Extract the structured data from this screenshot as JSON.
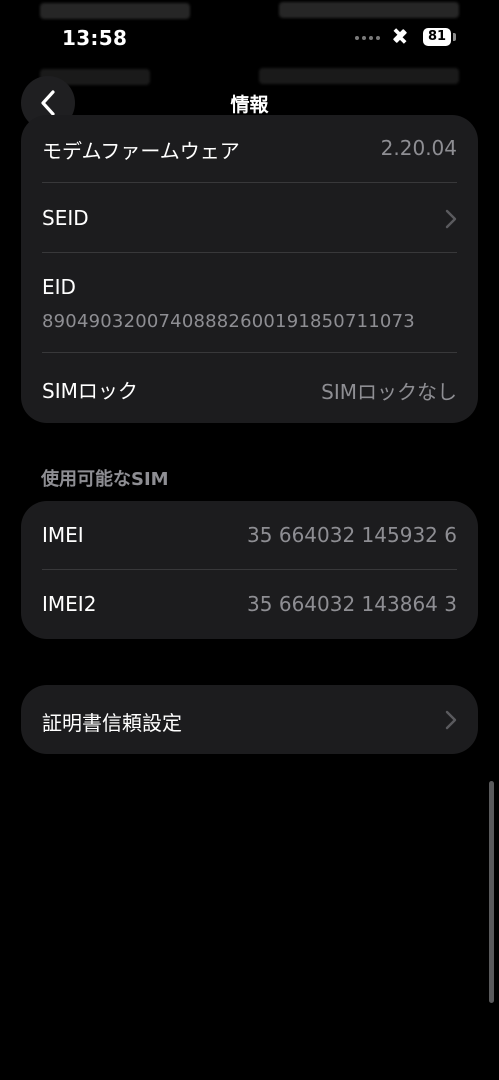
{
  "status_bar": {
    "time": "13:58",
    "battery": "81"
  },
  "nav": {
    "title": "情報"
  },
  "info_group": {
    "rows": [
      {
        "label": "モデムファームウェア",
        "value": "2.20.04"
      },
      {
        "label": "SEID"
      },
      {
        "label": "EID",
        "value": "89049032007408882600191850711073"
      },
      {
        "label": "SIMロック",
        "value": "SIMロックなし"
      }
    ]
  },
  "sim_section": {
    "header": "使用可能なSIM",
    "rows": [
      {
        "label": "IMEI",
        "value": "35 664032 145932 6"
      },
      {
        "label": "IMEI2",
        "value": "35 664032 143864 3"
      }
    ]
  },
  "cert_group": {
    "label": "証明書信頼設定"
  },
  "colors": {
    "background": "#000000",
    "cell": "#1c1c1e",
    "separator": "#38383a",
    "secondary_text": "#8e8e93"
  }
}
